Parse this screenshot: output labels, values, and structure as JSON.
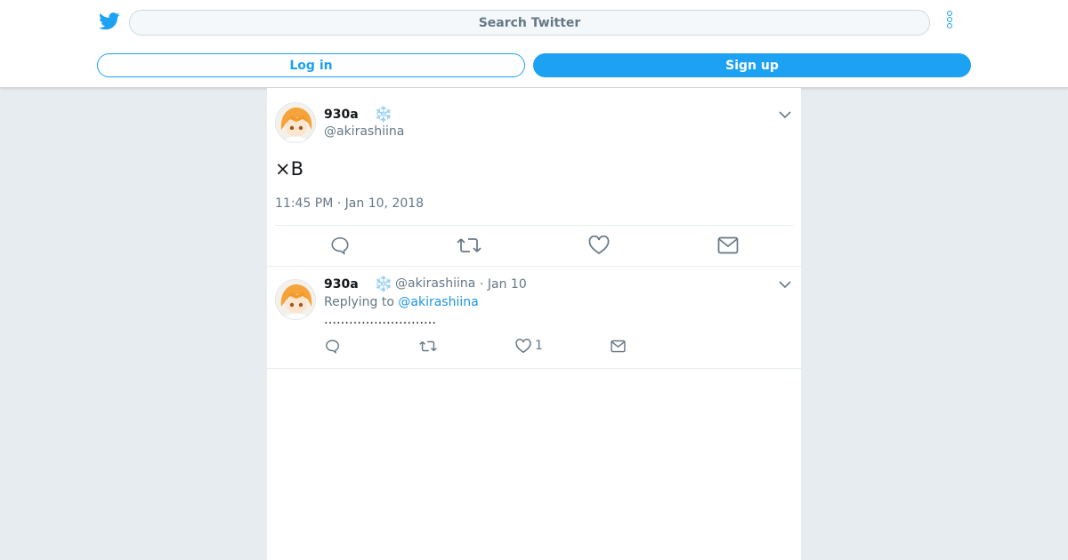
{
  "header": {
    "search_placeholder": "Search Twitter",
    "login_label": "Log in",
    "signup_label": "Sign up"
  },
  "colors": {
    "accent": "#1da1f2",
    "link": "#1b95e0",
    "muted": "#657786",
    "background": "#e6ecf0"
  },
  "main_tweet": {
    "author_name": "930a",
    "author_emoji": "❄️",
    "handle": "@akirashiina",
    "text": "×B",
    "timestamp": "11:45 PM · Jan 10, 2018",
    "actions": [
      "reply-icon",
      "retweet-icon",
      "like-icon",
      "share-icon"
    ]
  },
  "reply": {
    "author_name": "930a",
    "author_emoji": "❄️",
    "handle": "@akirashiina",
    "date": "· Jan 10",
    "replying_prefix": "Replying to",
    "replying_to": "@akirashiina",
    "text": "………………………",
    "like_count": "1"
  }
}
